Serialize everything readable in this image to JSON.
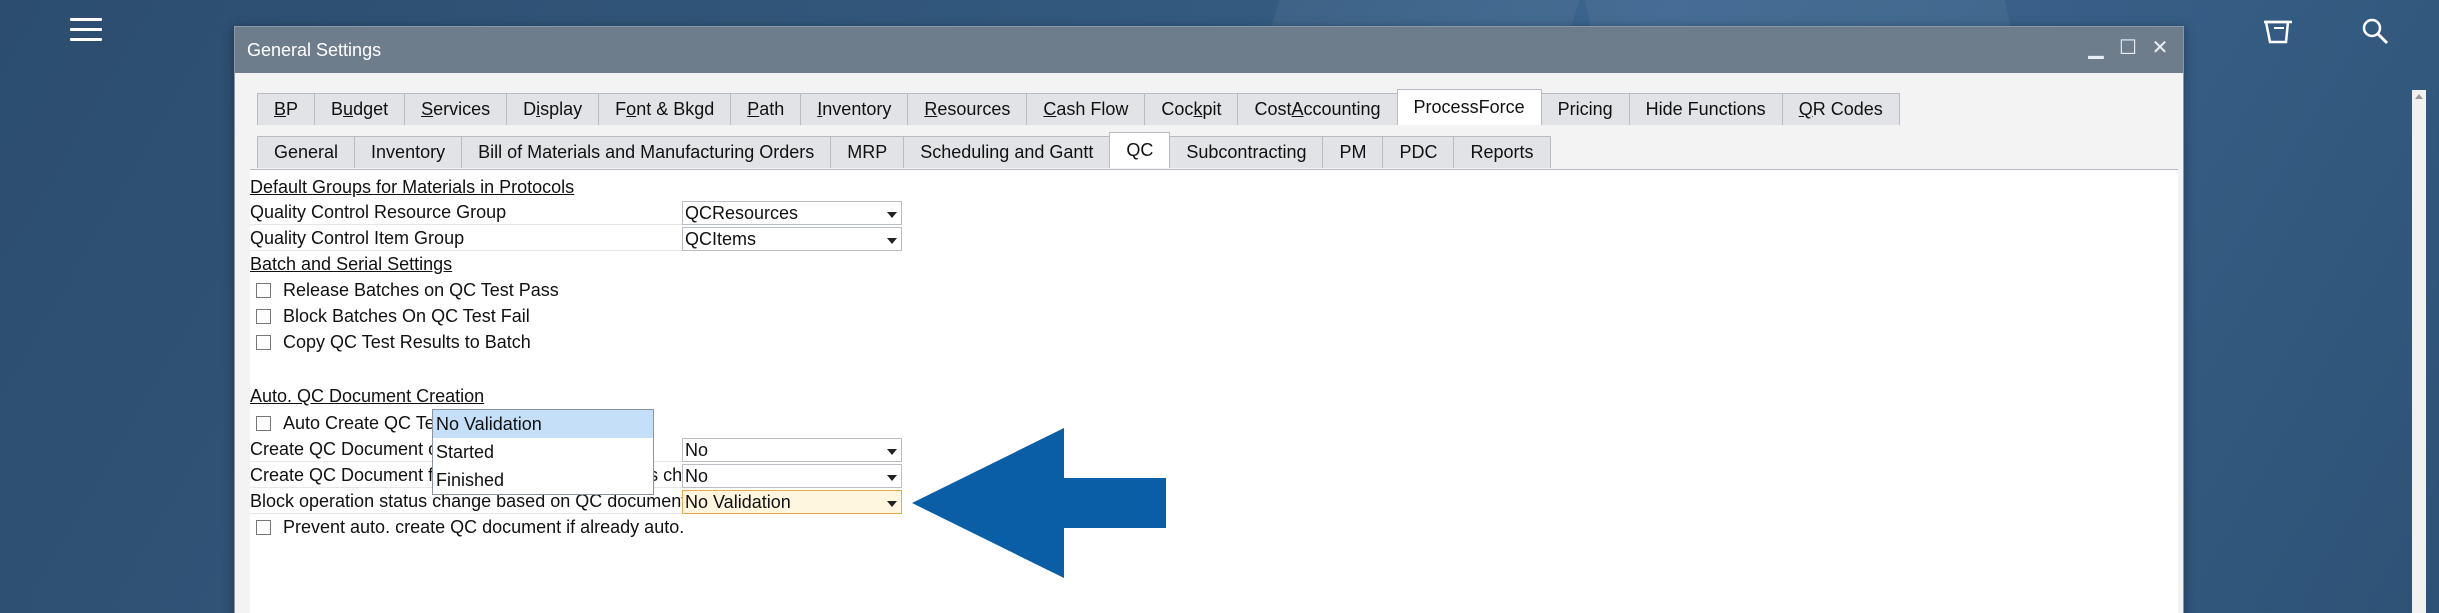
{
  "window": {
    "title": "General Settings"
  },
  "tabs_main": [
    {
      "pre": "",
      "mn": "B",
      "post": "P"
    },
    {
      "pre": "B",
      "mn": "u",
      "post": "dget"
    },
    {
      "pre": "",
      "mn": "S",
      "post": "ervices"
    },
    {
      "pre": "D",
      "mn": "i",
      "post": "splay"
    },
    {
      "pre": "F",
      "mn": "o",
      "post": "nt & Bkgd"
    },
    {
      "pre": "",
      "mn": "P",
      "post": "ath"
    },
    {
      "pre": "",
      "mn": "I",
      "post": "nventory"
    },
    {
      "pre": "",
      "mn": "R",
      "post": "esources"
    },
    {
      "pre": "",
      "mn": "C",
      "post": "ash Flow"
    },
    {
      "pre": "Coc",
      "mn": "k",
      "post": "pit"
    },
    {
      "pre": "Cost ",
      "mn": "A",
      "post": "ccounting"
    },
    {
      "pre": "ProcessForce",
      "mn": "",
      "post": ""
    },
    {
      "pre": "Pricing",
      "mn": "",
      "post": ""
    },
    {
      "pre": "Hide Functions",
      "mn": "",
      "post": ""
    },
    {
      "pre": "",
      "mn": "Q",
      "post": "R Codes"
    }
  ],
  "tabs_sub": [
    "General",
    "Inventory",
    "Bill of Materials and Manufacturing Orders",
    "MRP",
    "Scheduling and Gantt",
    "QC",
    "Subcontracting",
    "PM",
    "PDC",
    "Reports"
  ],
  "qc": {
    "section_groups": "Default Groups for Materials in Protocols",
    "resource_group_label": "Quality Control Resource Group",
    "resource_group_value": "QCResources",
    "item_group_label": "Quality Control Item Group",
    "item_group_value": "QCItems",
    "section_batch": "Batch and Serial Settings",
    "release_batches": "Release Batches on QC Test Pass",
    "block_batches": "Block Batches On QC Test Fail",
    "copy_results": "Copy QC Test Results to Batch",
    "section_auto": "Auto. QC Document Creation",
    "auto_create": "Auto Create QC Test Documents",
    "mor_status_label": "Create QC Document on MOR status change",
    "mor_status_value": "No",
    "operation_label": "Create QC Document for Operation on MOR status change",
    "operation_value": "No",
    "block_op_label": "Block operation status change based on QC document status",
    "block_op_value": "No Validation",
    "prevent_label": "Prevent auto. create QC document if already auto. created"
  },
  "dropdown": {
    "options": [
      "No Validation",
      "Started",
      "Finished"
    ],
    "selected": "No Validation"
  },
  "colors": {
    "annotation_arrow": "#0a5ea5",
    "titlebar": "#6e7d8c"
  }
}
